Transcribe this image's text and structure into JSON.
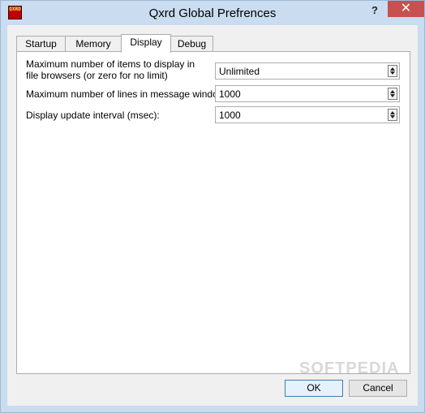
{
  "window": {
    "title": "Qxrd Global Prefrences",
    "help_label": "?",
    "close_label": "✕",
    "icon_name": "qxrd-app-icon",
    "icon_text": "QXRD"
  },
  "tabs": [
    {
      "label": "Startup",
      "active": false
    },
    {
      "label": "Memory",
      "active": false
    },
    {
      "label": "Display",
      "active": true
    },
    {
      "label": "Debug",
      "active": false
    }
  ],
  "display": {
    "max_items_label": "Maximum number of items to display in file browsers (or zero for no limit)",
    "max_items_value": "Unlimited",
    "max_lines_label": "Maximum number of lines in message window:",
    "max_lines_value": "1000",
    "update_interval_label": "Display update interval (msec):",
    "update_interval_value": "1000"
  },
  "buttons": {
    "ok": "OK",
    "cancel": "Cancel"
  },
  "watermark": "SOFTPEDIA",
  "colors": {
    "close": "#c75050",
    "titlebar": "#c9dcf0",
    "accent_border": "#3c7fb1"
  }
}
